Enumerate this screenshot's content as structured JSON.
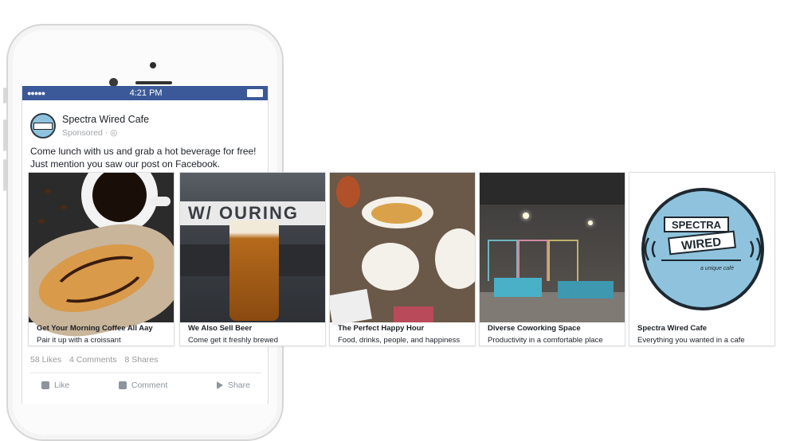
{
  "status_bar": {
    "signal": "●●●●●",
    "time": "4:21 PM"
  },
  "post": {
    "page_name": "Spectra Wired Cafe",
    "sponsored": "Sponsored · ",
    "text": "Come lunch with us and grab a hot beverage for free! Just mention you saw our post on Facebook."
  },
  "carousel": [
    {
      "title": "Get Your Morning Coffee All Aay",
      "desc": "Pair it up with a croissant"
    },
    {
      "title": "We Also Sell Beer",
      "desc": "Come get it freshly brewed"
    },
    {
      "title": "The Perfect Happy Hour",
      "desc": "Food, drinks, people, and happiness"
    },
    {
      "title": "Diverse Coworking Space",
      "desc": "Productivity in a comfortable place"
    },
    {
      "title": "Spectra Wired Cafe",
      "desc": "Everything you wanted in a cafe"
    }
  ],
  "logo": {
    "line1": "SPECTRA",
    "line2": "WIRED",
    "tagline": "a unique café"
  },
  "stats": {
    "likes": "58 Likes",
    "comments": "4 Comments",
    "shares": "8 Shares"
  },
  "actions": {
    "like": "Like",
    "comment": "Comment",
    "share": "Share"
  },
  "colors": {
    "facebook_blue": "#3b5998",
    "logo_blue": "#8fc3dd"
  }
}
